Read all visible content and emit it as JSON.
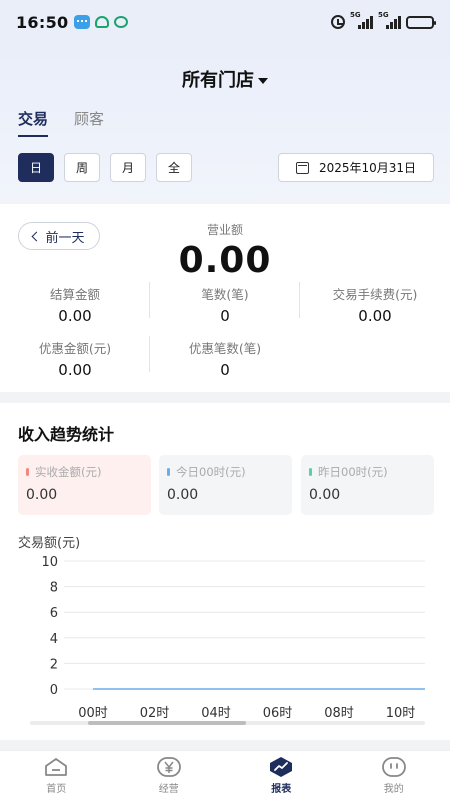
{
  "status_bar": {
    "time": "16:50",
    "signal_1": "5G",
    "signal_2": "5G"
  },
  "header": {
    "store_selector": "所有门店",
    "tabs": [
      {
        "label": "交易",
        "active": true
      },
      {
        "label": "顾客",
        "active": false
      }
    ],
    "periods": [
      {
        "label": "日",
        "active": true
      },
      {
        "label": "周",
        "active": false
      },
      {
        "label": "月",
        "active": false
      },
      {
        "label": "全",
        "active": false
      }
    ],
    "date": "2025年10月31日"
  },
  "summary": {
    "prev_day_label": "前一天",
    "revenue_label": "营业额",
    "revenue_value": "0.00",
    "metrics": [
      {
        "label": "结算金额",
        "value": "0.00"
      },
      {
        "label": "笔数(笔)",
        "value": "0"
      },
      {
        "label": "交易手续费(元)",
        "value": "0.00"
      },
      {
        "label": "优惠金额(元)",
        "value": "0.00"
      },
      {
        "label": "优惠笔数(笔)",
        "value": "0"
      }
    ]
  },
  "trend": {
    "title": "收入趋势统计",
    "cards": [
      {
        "label": "实收金额(元)",
        "value": "0.00",
        "color": "#f08a80"
      },
      {
        "label": "今日00时(元)",
        "value": "0.00",
        "color": "#6aaee8"
      },
      {
        "label": "昨日00时(元)",
        "value": "0.00",
        "color": "#5ccfa8"
      }
    ]
  },
  "chart_data": {
    "type": "line",
    "ylabel": "交易额(元)",
    "ylim": [
      0,
      10
    ],
    "yticks": [
      "0",
      "2",
      "4",
      "6",
      "8",
      "10"
    ],
    "x": [
      "00时",
      "02时",
      "04时",
      "06时",
      "08时",
      "10时"
    ],
    "series": [
      {
        "values": [
          0,
          0,
          0,
          0,
          0,
          0
        ],
        "color": "#6aaee8"
      }
    ],
    "grid": true
  },
  "bottom_nav": [
    {
      "label": "首页",
      "icon": "home-icon",
      "active": false
    },
    {
      "label": "经营",
      "icon": "yuan-icon",
      "active": false
    },
    {
      "label": "报表",
      "icon": "report-chart-icon",
      "active": true
    },
    {
      "label": "我的",
      "icon": "profile-face-icon",
      "active": false
    }
  ]
}
